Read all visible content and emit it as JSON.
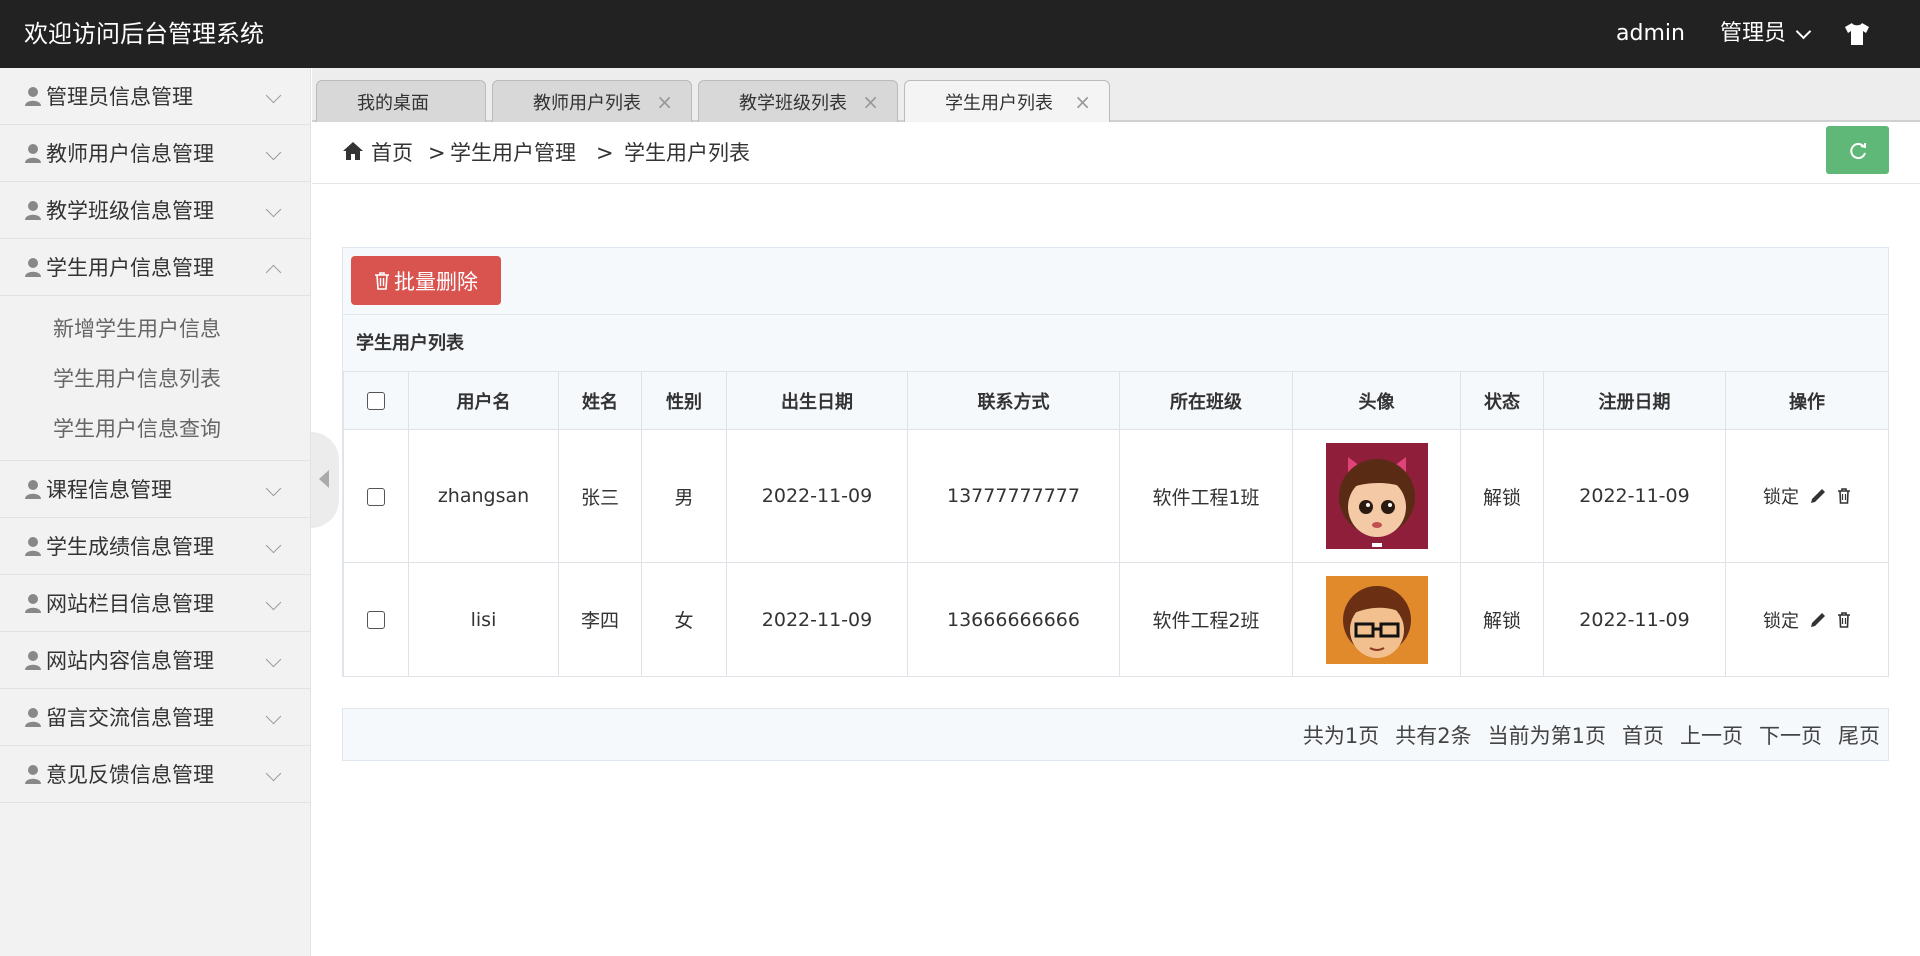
{
  "header": {
    "title": "欢迎访问后台管理系统",
    "username": "admin",
    "role": "管理员"
  },
  "sidebar": {
    "items": [
      {
        "label": "管理员信息管理"
      },
      {
        "label": "教师用户信息管理"
      },
      {
        "label": "教学班级信息管理"
      },
      {
        "label": "学生用户信息管理",
        "expanded": true,
        "children": [
          {
            "label": "新增学生用户信息"
          },
          {
            "label": "学生用户信息列表"
          },
          {
            "label": "学生用户信息查询"
          }
        ]
      },
      {
        "label": "课程信息管理"
      },
      {
        "label": "学生成绩信息管理"
      },
      {
        "label": "网站栏目信息管理"
      },
      {
        "label": "网站内容信息管理"
      },
      {
        "label": "留言交流信息管理"
      },
      {
        "label": "意见反馈信息管理"
      }
    ]
  },
  "tabs": [
    {
      "label": "我的桌面",
      "closable": false
    },
    {
      "label": "教师用户列表",
      "closable": true
    },
    {
      "label": "教学班级列表",
      "closable": true
    },
    {
      "label": "学生用户列表",
      "closable": true,
      "active": true
    }
  ],
  "breadcrumb": {
    "home": "首页",
    "level1": "学生用户管理",
    "level2": "学生用户列表",
    "separator": ">"
  },
  "toolbar": {
    "batch_delete": "批量删除"
  },
  "table": {
    "caption": "学生用户列表",
    "columns": [
      "用户名",
      "姓名",
      "性别",
      "出生日期",
      "联系方式",
      "所在班级",
      "头像",
      "状态",
      "注册日期",
      "操作"
    ],
    "rows": [
      {
        "username": "zhangsan",
        "name": "张三",
        "gender": "男",
        "birthdate": "2022-11-09",
        "phone": "13777777777",
        "class": "软件工程1班",
        "status": "解锁",
        "registered": "2022-11-09",
        "lock_label": "锁定"
      },
      {
        "username": "lisi",
        "name": "李四",
        "gender": "女",
        "birthdate": "2022-11-09",
        "phone": "13666666666",
        "class": "软件工程2班",
        "status": "解锁",
        "registered": "2022-11-09",
        "lock_label": "锁定"
      }
    ]
  },
  "pager": {
    "total_pages": "共为1页",
    "total_items": "共有2条",
    "current": "当前为第1页",
    "first": "首页",
    "prev": "上一页",
    "next": "下一页",
    "last": "尾页"
  },
  "colors": {
    "header_bg": "#222222",
    "danger": "#d9534f",
    "success": "#5fb878"
  },
  "icons": [
    "shirt-icon",
    "person-icon",
    "chevron-down-icon",
    "chevron-up-icon",
    "home-icon",
    "refresh-icon",
    "trash-icon",
    "pencil-icon",
    "close-icon",
    "collapse-arrow-icon"
  ]
}
